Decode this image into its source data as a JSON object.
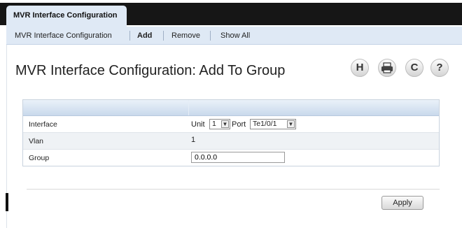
{
  "header": {
    "active_tab": "MVR Interface Configuration"
  },
  "subnav": {
    "items": [
      {
        "label": "MVR Interface Configuration"
      },
      {
        "label": "Add"
      },
      {
        "label": "Remove"
      },
      {
        "label": "Show All"
      }
    ],
    "active_index": 1
  },
  "page": {
    "title": "MVR Interface Configuration: Add To Group"
  },
  "toolbar": {
    "save_icon": "H",
    "print_icon": "printer",
    "refresh_icon": "C",
    "help_icon": "?"
  },
  "form": {
    "interface": {
      "label": "Interface",
      "unit_label": "Unit",
      "unit_value": "1",
      "port_label": "Port",
      "port_value": "Te1/0/1"
    },
    "vlan": {
      "label": "Vlan",
      "value": "1"
    },
    "group": {
      "label": "Group",
      "value": "0.0.0.0"
    }
  },
  "actions": {
    "apply_label": "Apply"
  }
}
